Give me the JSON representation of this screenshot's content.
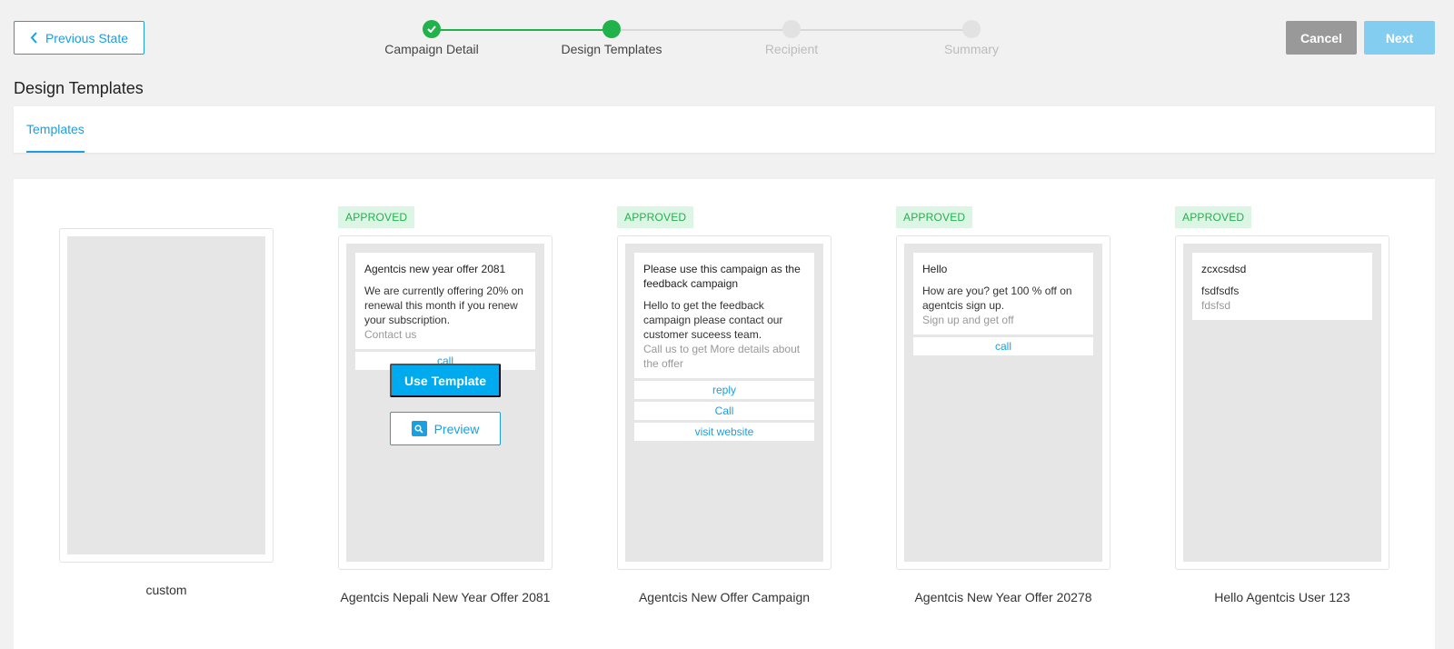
{
  "header": {
    "previous_label": "Previous State",
    "cancel_label": "Cancel",
    "next_label": "Next"
  },
  "steps": [
    {
      "label": "Campaign Detail",
      "status": "done"
    },
    {
      "label": "Design Templates",
      "status": "active"
    },
    {
      "label": "Recipient",
      "status": "pending"
    },
    {
      "label": "Summary",
      "status": "pending"
    }
  ],
  "page_title": "Design Templates",
  "tabs": [
    {
      "label": "Templates",
      "active": true
    }
  ],
  "colors": {
    "accent": "#1a9fe0",
    "success": "#22b24c",
    "use_template": "#00aaee",
    "cancel": "#999999",
    "next_disabled": "#83cdf0"
  },
  "templates": [
    {
      "name": "custom",
      "badge": "",
      "heading": "",
      "body": "",
      "footer": "",
      "actions": []
    },
    {
      "name": "Agentcis Nepali New Year Offer 2081",
      "badge": "APPROVED",
      "heading": "Agentcis new year offer 2081",
      "body": "We are currently offering 20% on renewal this month if you renew your subscription.",
      "footer": "Contact us",
      "actions": [
        "call"
      ],
      "hover": {
        "use_label": "Use Template",
        "preview_label": "Preview"
      }
    },
    {
      "name": "Agentcis New Offer Campaign",
      "badge": "APPROVED",
      "heading": "Please use this campaign as the feedback campaign",
      "body": "Hello to get the feedback campaign please contact our customer suceess team.",
      "footer": "Call us to get More details about the offer",
      "actions": [
        "reply",
        "Call",
        "visit website"
      ]
    },
    {
      "name": "Agentcis New Year Offer 20278",
      "badge": "APPROVED",
      "heading": "Hello",
      "body": "How are you? get 100 % off on agentcis sign up.",
      "footer": "Sign up and get off",
      "actions": [
        "call"
      ]
    },
    {
      "name": "Hello Agentcis User 123",
      "badge": "APPROVED",
      "heading": "zcxcsdsd",
      "body": "fsdfsdfs",
      "footer": "fdsfsd",
      "actions": []
    }
  ]
}
